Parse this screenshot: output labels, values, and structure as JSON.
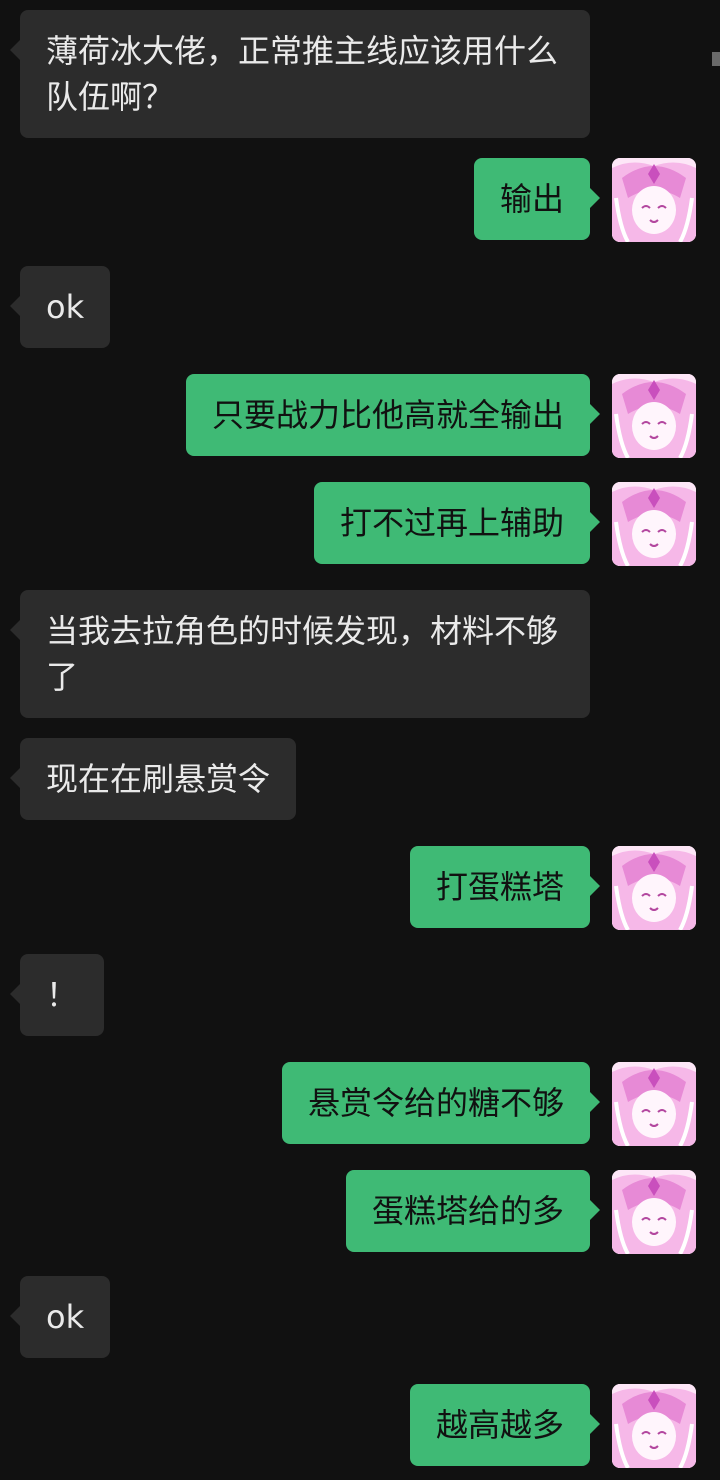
{
  "messages": [
    {
      "side": "in",
      "text": "薄荷冰大佬，正常推主线应该用什么队伍啊？"
    },
    {
      "side": "out",
      "text": "输出"
    },
    {
      "side": "in",
      "text": "ok"
    },
    {
      "side": "out",
      "text": "只要战力比他高就全输出"
    },
    {
      "side": "out",
      "text": "打不过再上辅助"
    },
    {
      "side": "in",
      "text": "当我去拉角色的时候发现，材料不够了"
    },
    {
      "side": "in",
      "text": "现在在刷悬赏令"
    },
    {
      "side": "out",
      "text": "打蛋糕塔"
    },
    {
      "side": "in",
      "text": "！"
    },
    {
      "side": "out",
      "text": "悬赏令给的糖不够"
    },
    {
      "side": "out",
      "text": "蛋糕塔给的多"
    },
    {
      "side": "in",
      "text": "ok"
    },
    {
      "side": "out",
      "text": "越高越多"
    }
  ],
  "colors": {
    "background": "#111111",
    "incoming_bubble": "#2c2c2c",
    "outgoing_bubble": "#3fba75",
    "incoming_text": "#eaeaea",
    "outgoing_text": "#111111"
  },
  "avatar_icon": "pink-anime-character-avatar"
}
